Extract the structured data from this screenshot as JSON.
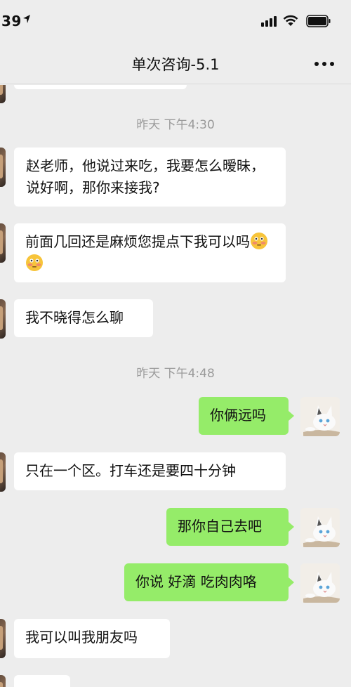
{
  "status_bar": {
    "time": "39"
  },
  "header": {
    "title": "单次咨询-5.1"
  },
  "messages": {
    "ts1": "昨天 下午4:30",
    "m1": "赵老师，他说过来吃，我要怎么暧昧，说好啊，那你来接我?",
    "m2": "前面几回还是麻烦您提点下我可以吗",
    "m3": "我不晓得怎么聊",
    "ts2": "昨天 下午4:48",
    "m4": "你俩远吗",
    "m5": "只在一个区。打车还是要四十分钟",
    "m6": "那你自己去吧",
    "m7": "你说 好滴 吃肉肉咯",
    "m8": "我可以叫我朋友吗"
  },
  "colors": {
    "outgoing": "#95ec69",
    "incoming": "#ffffff",
    "background": "#ededed"
  },
  "icons": [
    "location-arrow-icon",
    "signal-icon",
    "wifi-icon",
    "battery-icon",
    "more-icon",
    "flushed-emoji-icon"
  ]
}
